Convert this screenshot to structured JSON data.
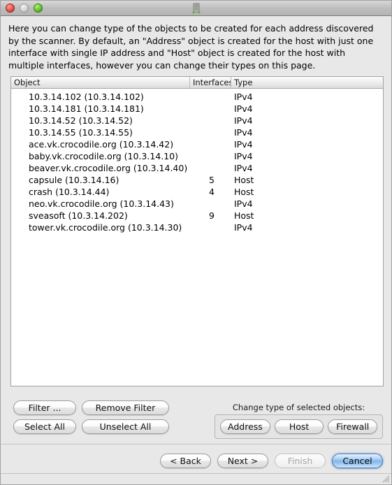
{
  "window": {
    "title": "",
    "icon": "firewall-tower-icon",
    "traffic_lights": [
      {
        "name": "close",
        "label": "Close",
        "color": "#e8554a",
        "enabled": true
      },
      {
        "name": "minimize",
        "label": "Minimize",
        "color": "#d4d4d4",
        "enabled": false
      },
      {
        "name": "zoom",
        "label": "Zoom",
        "color": "#63c22b",
        "enabled": true
      }
    ]
  },
  "description": "Here you can change type of the objects to be created for each address discovered by the scanner. By default, an \"Address\" object is created for the host with just one interface with single IP address and \"Host\" object is created for the host with multiple interfaces, however you can change their types on this page.",
  "table": {
    "columns": [
      "Object",
      "Interfaces",
      "Type"
    ],
    "rows": [
      {
        "object": "10.3.14.102 (10.3.14.102)",
        "interfaces": "",
        "type": "IPv4"
      },
      {
        "object": "10.3.14.181 (10.3.14.181)",
        "interfaces": "",
        "type": "IPv4"
      },
      {
        "object": "10.3.14.52 (10.3.14.52)",
        "interfaces": "",
        "type": "IPv4"
      },
      {
        "object": "10.3.14.55 (10.3.14.55)",
        "interfaces": "",
        "type": "IPv4"
      },
      {
        "object": "ace.vk.crocodile.org (10.3.14.42)",
        "interfaces": "",
        "type": "IPv4"
      },
      {
        "object": "baby.vk.crocodile.org (10.3.14.10)",
        "interfaces": "",
        "type": "IPv4"
      },
      {
        "object": "beaver.vk.crocodile.org (10.3.14.40)",
        "interfaces": "",
        "type": "IPv4"
      },
      {
        "object": "capsule (10.3.14.16)",
        "interfaces": "5",
        "type": "Host"
      },
      {
        "object": "crash (10.3.14.44)",
        "interfaces": "4",
        "type": "Host"
      },
      {
        "object": "neo.vk.crocodile.org (10.3.14.43)",
        "interfaces": "",
        "type": "IPv4"
      },
      {
        "object": "sveasoft (10.3.14.202)",
        "interfaces": "9",
        "type": "Host"
      },
      {
        "object": "tower.vk.crocodile.org (10.3.14.30)",
        "interfaces": "",
        "type": "IPv4"
      }
    ]
  },
  "filter_buttons": {
    "filter": "Filter ...",
    "remove_filter": "Remove Filter",
    "select_all": "Select All",
    "unselect_all": "Unselect All"
  },
  "change_type": {
    "label": "Change type of selected objects:",
    "address": "Address",
    "host": "Host",
    "firewall": "Firewall"
  },
  "nav": {
    "back": "< Back",
    "next": "Next >",
    "finish": "Finish",
    "cancel": "Cancel",
    "finish_enabled": false,
    "cancel_is_default": true,
    "default_color": "#82b6ec"
  }
}
